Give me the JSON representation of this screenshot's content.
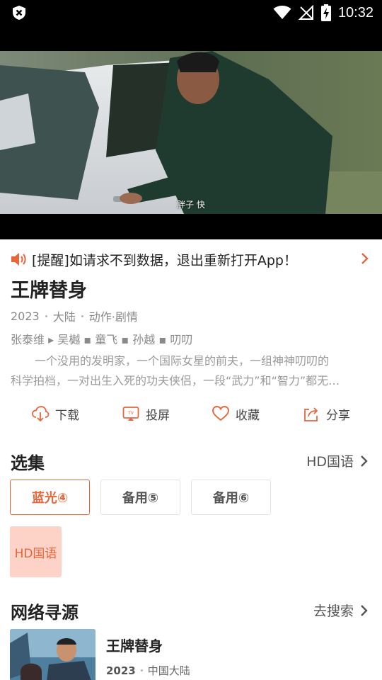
{
  "status_bar": {
    "time": "10:32"
  },
  "video": {
    "subtitle": "胖子 快"
  },
  "notice": {
    "text": "[提醒]如请求不到数据，退出重新打开App！"
  },
  "movie": {
    "title": "王牌替身",
    "year": "2023",
    "region": "大陆",
    "genre": "动作·剧情",
    "cast": "张泰维 ▸ 吴樾 ▪ 童飞 ▪ 孙越 ▪ 叨叨",
    "description_line1": "一个没用的发明家，一个国际女星的前夫，一组神神叨叨的",
    "description_line2": "科学拍档，一对出生入死的功夫侠侣，一段“武力”和“智力”都无…"
  },
  "actions": [
    {
      "label": "下载",
      "icon": "download-icon"
    },
    {
      "label": "投屏",
      "icon": "cast-icon"
    },
    {
      "label": "收藏",
      "icon": "heart-icon"
    },
    {
      "label": "分享",
      "icon": "share-icon"
    }
  ],
  "episodes_section": {
    "title": "选集",
    "link": "HD国语",
    "items": [
      "蓝光④",
      "备用⑤",
      "备用⑥"
    ],
    "selected": "蓝光④",
    "source_chip": "HD国语"
  },
  "network_section": {
    "title": "网络寻源",
    "link": "去搜索",
    "result": {
      "title": "王牌替身",
      "year": "2023",
      "region": "中国大陆"
    }
  },
  "colors": {
    "accent": "#e7663b",
    "accent_light": "#fdd3c8",
    "status_bar": "#000000"
  }
}
